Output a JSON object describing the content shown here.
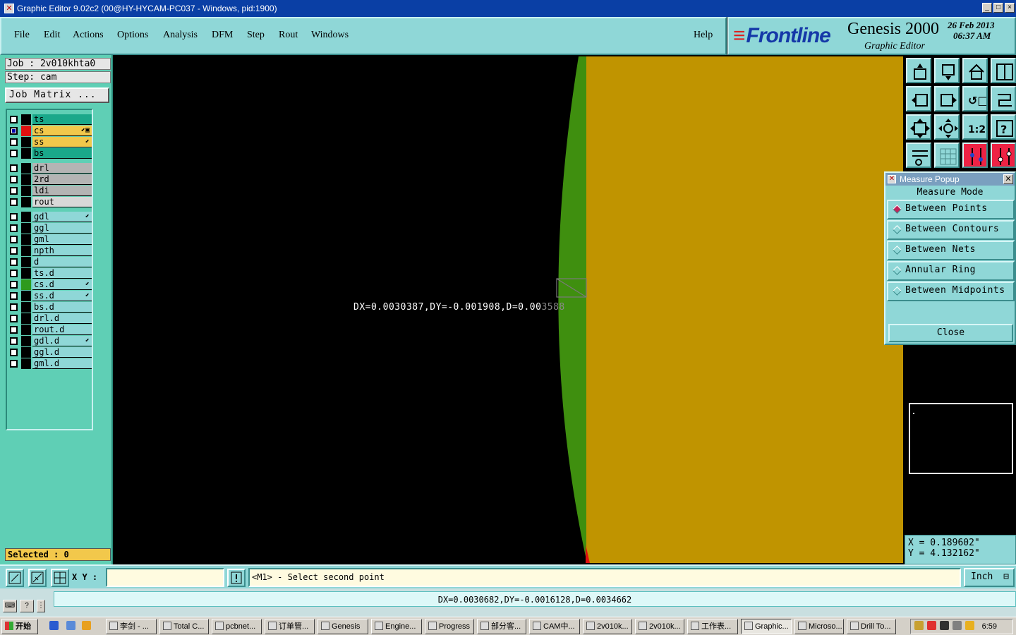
{
  "window": {
    "title": "Graphic Editor 9.02c2 (00@HY-HYCAM-PC037 - Windows, pid:1900)",
    "controls": [
      "_",
      "□",
      "×"
    ]
  },
  "menu": {
    "items": [
      "File",
      "Edit",
      "Actions",
      "Options",
      "Analysis",
      "DFM",
      "Step",
      "Rout",
      "Windows"
    ],
    "help": "Help"
  },
  "brand": {
    "logo": "Frontline",
    "product": "Genesis 2000",
    "subtitle": "Graphic Editor",
    "date": "26 Feb 2013",
    "time": "06:37 AM"
  },
  "job": {
    "job_line": "Job : 2v010khta0",
    "step_line": "Step: cam",
    "matrix_button": "Job Matrix ..."
  },
  "layers": [
    {
      "name": "ts",
      "color": "#1aa88a",
      "swatch": "#000000",
      "mark": "",
      "selected": false
    },
    {
      "name": "cs",
      "color": "#f2c84b",
      "swatch": "#e01010",
      "mark": "⬋▣",
      "selected": true
    },
    {
      "name": "ss",
      "color": "#f2c84b",
      "swatch": "#000000",
      "mark": "⬋",
      "selected": false
    },
    {
      "name": "bs",
      "color": "#1aa88a",
      "swatch": "#000000",
      "mark": "",
      "selected": false
    },
    {
      "name": "drl",
      "color": "#b4b4b4",
      "swatch": "#000000",
      "mark": "",
      "selected": false
    },
    {
      "name": "2rd",
      "color": "#b4b4b4",
      "swatch": "#000000",
      "mark": "",
      "selected": false
    },
    {
      "name": "ldi",
      "color": "#b4b4b4",
      "swatch": "#000000",
      "mark": "",
      "selected": false
    },
    {
      "name": "rout",
      "color": "#d8d8d8",
      "swatch": "#000000",
      "mark": "",
      "selected": false
    },
    {
      "name": "gdl",
      "color": "#8fd7d7",
      "swatch": "#000000",
      "mark": "⬋",
      "selected": false
    },
    {
      "name": "ggl",
      "color": "#8fd7d7",
      "swatch": "#000000",
      "mark": "",
      "selected": false
    },
    {
      "name": "gml",
      "color": "#8fd7d7",
      "swatch": "#000000",
      "mark": "",
      "selected": false
    },
    {
      "name": "npth",
      "color": "#8fd7d7",
      "swatch": "#000000",
      "mark": "",
      "selected": false
    },
    {
      "name": "d",
      "color": "#8fd7d7",
      "swatch": "#000000",
      "mark": "",
      "selected": false
    },
    {
      "name": "ts.d",
      "color": "#8fd7d7",
      "swatch": "#000000",
      "mark": "",
      "selected": false
    },
    {
      "name": "cs.d",
      "color": "#8fd7d7",
      "swatch": "#2e9a1e",
      "mark": "⬋",
      "selected": false
    },
    {
      "name": "ss.d",
      "color": "#8fd7d7",
      "swatch": "#000000",
      "mark": "⬋",
      "selected": false
    },
    {
      "name": "bs.d",
      "color": "#8fd7d7",
      "swatch": "#000000",
      "mark": "",
      "selected": false
    },
    {
      "name": "drl.d",
      "color": "#8fd7d7",
      "swatch": "#000000",
      "mark": "",
      "selected": false
    },
    {
      "name": "rout.d",
      "color": "#8fd7d7",
      "swatch": "#000000",
      "mark": "",
      "selected": false
    },
    {
      "name": "gdl.d",
      "color": "#8fd7d7",
      "swatch": "#000000",
      "mark": "⬋",
      "selected": false
    },
    {
      "name": "ggl.d",
      "color": "#8fd7d7",
      "swatch": "#000000",
      "mark": "",
      "selected": false
    },
    {
      "name": "gml.d",
      "color": "#8fd7d7",
      "swatch": "#000000",
      "mark": "",
      "selected": false
    }
  ],
  "selected_count": "Selected : 0",
  "canvas": {
    "measure_text_white": "DX=0.0030387,DY=-0.001908,D=0.00",
    "measure_text_grey": "3588",
    "colors": {
      "background": "#000000",
      "copper": "#c09400",
      "edge": "#3f8f0f"
    }
  },
  "toolbar_icons": [
    "zoom-in-icon",
    "zoom-out-icon",
    "home-icon",
    "split-view-icon",
    "pan-left-icon",
    "pan-right-icon",
    "undo-icon",
    "redo-icon",
    "fit-screen-icon",
    "fit-profile-icon",
    "one-to-one-icon",
    "help-icon",
    "settings-icon",
    "grid-icon",
    "snap-icon",
    "drc-icon"
  ],
  "measure_popup": {
    "title": "Measure Popup",
    "mode_label": "Measure Mode",
    "options": [
      {
        "label": "Between Points",
        "active": true
      },
      {
        "label": "Between Contours",
        "active": false
      },
      {
        "label": "Between Nets",
        "active": false
      },
      {
        "label": "Annular Ring",
        "active": false
      },
      {
        "label": "Between Midpoints",
        "active": false
      }
    ],
    "close_label": "Close"
  },
  "coords": {
    "x": "X = 0.189602\"",
    "y": "Y = 4.132162\""
  },
  "command": {
    "xy_label": "X Y :",
    "xy_value": "",
    "prompt": "<M1> - Select second point",
    "unit": "Inch"
  },
  "status": {
    "message": "DX=0.0030682,DY=-0.0016128,D=0.0034662"
  },
  "taskbar": {
    "start": "开始",
    "tasks": [
      "李剑 - ...",
      "Total C...",
      "pcbnet...",
      "订单管...",
      "Genesis",
      "Engine...",
      "Progress",
      "部分客...",
      "CAM中...",
      "2v010k...",
      "2v010k...",
      "工作表...",
      "Graphic...",
      "Microso...",
      "Drill To..."
    ],
    "active_task": "Graphic...",
    "clock": "6:59"
  }
}
